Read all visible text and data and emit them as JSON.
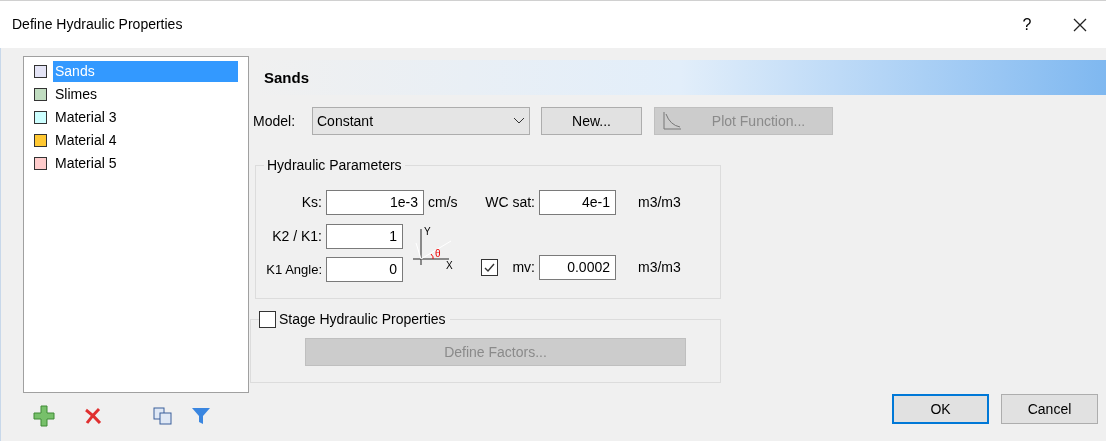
{
  "window": {
    "title": "Define Hydraulic Properties",
    "help": "?"
  },
  "materials": [
    {
      "name": "Sands",
      "color": "#e4e4f6",
      "selected": true
    },
    {
      "name": "Slimes",
      "color": "#c0dcc0",
      "selected": false
    },
    {
      "name": "Material 3",
      "color": "#ccffff",
      "selected": false
    },
    {
      "name": "Material 4",
      "color": "#ffc832",
      "selected": false
    },
    {
      "name": "Material 5",
      "color": "#ffcccc",
      "selected": false
    }
  ],
  "header": "Sands",
  "model": {
    "label": "Model:",
    "value": "Constant"
  },
  "new_button": {
    "label": "New...",
    "disabled": false
  },
  "plot_button": {
    "label": "Plot Function...",
    "disabled": true
  },
  "hydraulic": {
    "title": "Hydraulic Parameters",
    "ks": {
      "label": "Ks:",
      "value": "1e-3",
      "unit": "cm/s"
    },
    "k2k1": {
      "label": "K2 / K1:",
      "value": "1"
    },
    "k1angle": {
      "label": "K1 Angle:",
      "value": "0"
    },
    "wcsat": {
      "label": "WC sat:",
      "value": "4e-1",
      "unit": "m3/m3"
    },
    "mv": {
      "label": "mv:",
      "value": "0.0002",
      "unit": "m3/m3",
      "checked": true
    },
    "diagram": {
      "y": "Y",
      "x": "X",
      "theta": "θ"
    }
  },
  "stage": {
    "label": "Stage Hydraulic Properties",
    "checked": false,
    "button": {
      "label": "Define Factors...",
      "disabled": true
    }
  },
  "buttons": [
    {
      "label": "OK",
      "selected": true
    },
    {
      "label": "Cancel",
      "selected": false
    }
  ]
}
